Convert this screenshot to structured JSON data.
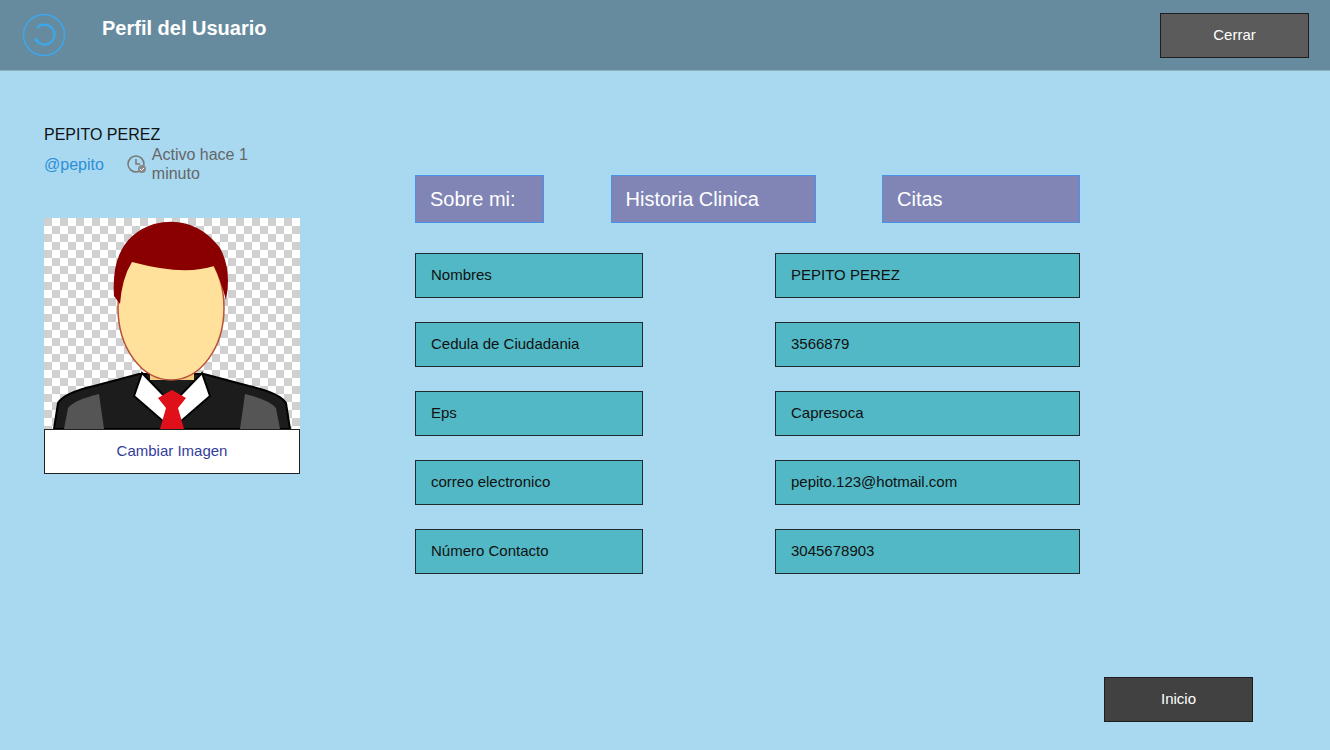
{
  "header": {
    "title": "Perfil del Usuario",
    "close_button": "Cerrar"
  },
  "user": {
    "name": "PEPITO PEREZ",
    "handle": "@pepito",
    "activity": "Activo hace 1 minuto"
  },
  "avatar": {
    "change_button": "Cambiar Imagen"
  },
  "tabs": [
    {
      "label": "Sobre mi:",
      "selected": false
    },
    {
      "label": "Historia Clinica",
      "selected": false
    },
    {
      "label": "Citas",
      "selected": false
    }
  ],
  "fields": [
    {
      "label": "Nombres",
      "value": "PEPITO PEREZ"
    },
    {
      "label": "Cedula de Ciudadania",
      "value": "3566879"
    },
    {
      "label": "Eps",
      "value": "Capresoca"
    },
    {
      "label": "correo electronico",
      "value": "pepito.123@hotmail.com"
    },
    {
      "label": "Número Contacto",
      "value": "3045678903"
    }
  ],
  "footer": {
    "home_button": "Inicio"
  }
}
